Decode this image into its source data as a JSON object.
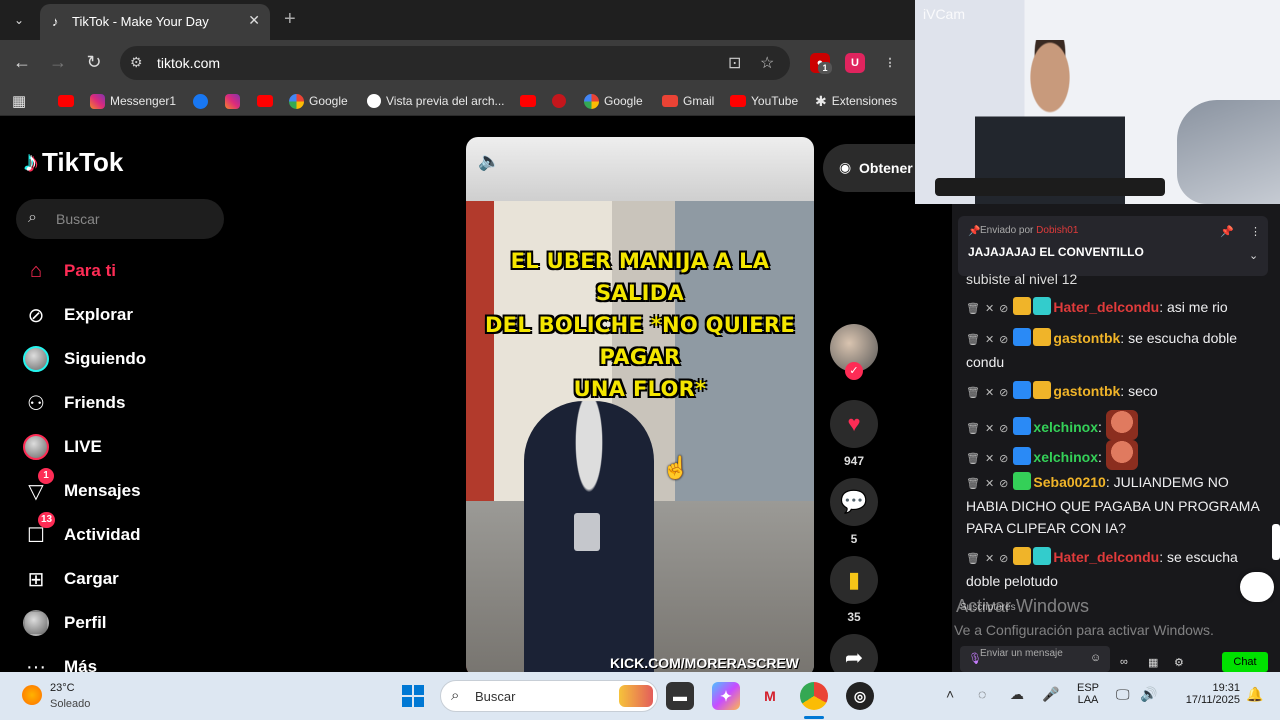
{
  "browser": {
    "tab_title": "TikTok - Make Your Day",
    "url": "tiktok.com",
    "ext_badge": "1",
    "bookmarks": [
      "Messenger1",
      "Google",
      "Vista previa del arch...",
      "Google",
      "Gmail",
      "YouTube",
      "Extensiones"
    ]
  },
  "tiktok": {
    "logo": "TikTok",
    "search_placeholder": "Buscar",
    "nav": [
      {
        "label": "Para ti",
        "icon": "home-icon"
      },
      {
        "label": "Explorar",
        "icon": "compass-icon"
      },
      {
        "label": "Siguiendo",
        "icon": "following-avatar-icon"
      },
      {
        "label": "Friends",
        "icon": "friends-icon"
      },
      {
        "label": "LIVE",
        "icon": "live-icon"
      },
      {
        "label": "Mensajes",
        "icon": "messages-icon",
        "badge": "1"
      },
      {
        "label": "Actividad",
        "icon": "activity-icon",
        "badge": "13"
      },
      {
        "label": "Cargar",
        "icon": "upload-icon"
      },
      {
        "label": "Perfil",
        "icon": "profile-avatar-icon"
      },
      {
        "label": "Más",
        "icon": "more-icon"
      }
    ],
    "video": {
      "caption_lines": [
        "EL UBER MANIJA A LA SALIDA",
        "DEL BOLICHE *NO QUIERE PAGAR",
        "UNA FLOR*"
      ],
      "watermark": "KICK.COM/MORERASCREW"
    },
    "get_app_label": "Obtener",
    "likes": "947",
    "comments": "5",
    "saves": "35",
    "accent_color": "#fe2c55"
  },
  "webcam": {
    "label": "iVCam"
  },
  "chat": {
    "pinned": {
      "sent_by_label": "Enviado por",
      "sender": "Dobish01",
      "message": "JAJAJAJAJ EL CONVENTILLO"
    },
    "partial_line": "subiste al nivel 12",
    "messages": [
      {
        "user": "Hater_delcondu",
        "user_color": "#e03b3b",
        "text": ": asi me rio"
      },
      {
        "user": "gastontbk",
        "user_color": "#f0b429",
        "text": ": se escucha doble condu"
      },
      {
        "user": "gastontbk",
        "user_color": "#f0b429",
        "text": ": seco"
      },
      {
        "user": "xelchinox",
        "user_color": "#34d058",
        "text": ":"
      },
      {
        "user": "xelchinox",
        "user_color": "#34d058",
        "text": ":"
      },
      {
        "user": "Seba00210",
        "user_color": "#f0b429",
        "text": ": JULIANDEMG NO HABIA DICHO QUE PAGABA UN PROGRAMA PARA CLIPEAR CON IA?"
      },
      {
        "user": "Hater_delcondu",
        "user_color": "#e03b3b",
        "text": ": se escucha doble pelotudo"
      }
    ],
    "sponsor_label": "Suscriptores",
    "activate_title": "Activar Windows",
    "activate_sub": "Ve a Configuración para activar Windows.",
    "input_placeholder": "Enviar un mensaje",
    "chat_button": "Chat"
  },
  "taskbar": {
    "temp": "23°C",
    "condition": "Soleado",
    "search_placeholder": "Buscar",
    "lang_top": "ESP",
    "lang_bottom": "LAA",
    "time": "19:31",
    "date": "17/11/2025"
  }
}
